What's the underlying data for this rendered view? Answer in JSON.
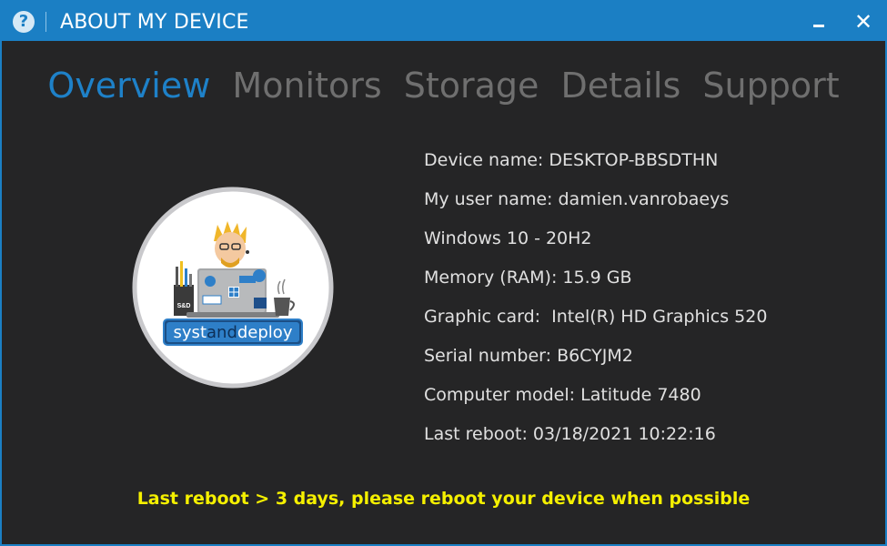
{
  "window": {
    "title": "ABOUT MY DEVICE",
    "help_glyph": "?",
    "close_glyph": "✕"
  },
  "tabs": [
    {
      "label": "Overview",
      "active": true
    },
    {
      "label": "Monitors",
      "active": false
    },
    {
      "label": "Storage",
      "active": false
    },
    {
      "label": "Details",
      "active": false
    },
    {
      "label": "Support",
      "active": false
    }
  ],
  "logo": {
    "brand": "systanddeploy",
    "brand_part1": "syst",
    "brand_part2": "and",
    "brand_part3": "deploy",
    "cup_label": "S&D"
  },
  "info": [
    {
      "label": "Device name: ",
      "value": "DESKTOP-BBSDTHN"
    },
    {
      "label": "My user name: ",
      "value": "damien.vanrobaeys"
    },
    {
      "label": "",
      "value": "Windows 10 - 20H2"
    },
    {
      "label": "Memory (RAM): ",
      "value": "15.9 GB"
    },
    {
      "label": "Graphic card:  ",
      "value": "Intel(R) HD Graphics 520"
    },
    {
      "label": "Serial number: ",
      "value": "B6CYJM2"
    },
    {
      "label": "Computer model: ",
      "value": "Latitude 7480"
    },
    {
      "label": "Last reboot: ",
      "value": "03/18/2021 10:22:16"
    }
  ],
  "warning": "Last reboot > 3 days, please reboot your device when possible",
  "colors": {
    "accent": "#1b7fc4",
    "active_tab": "#1e81c8",
    "inactive_tab": "#6f6f6f",
    "background": "#252526",
    "warning": "#f5f000"
  }
}
